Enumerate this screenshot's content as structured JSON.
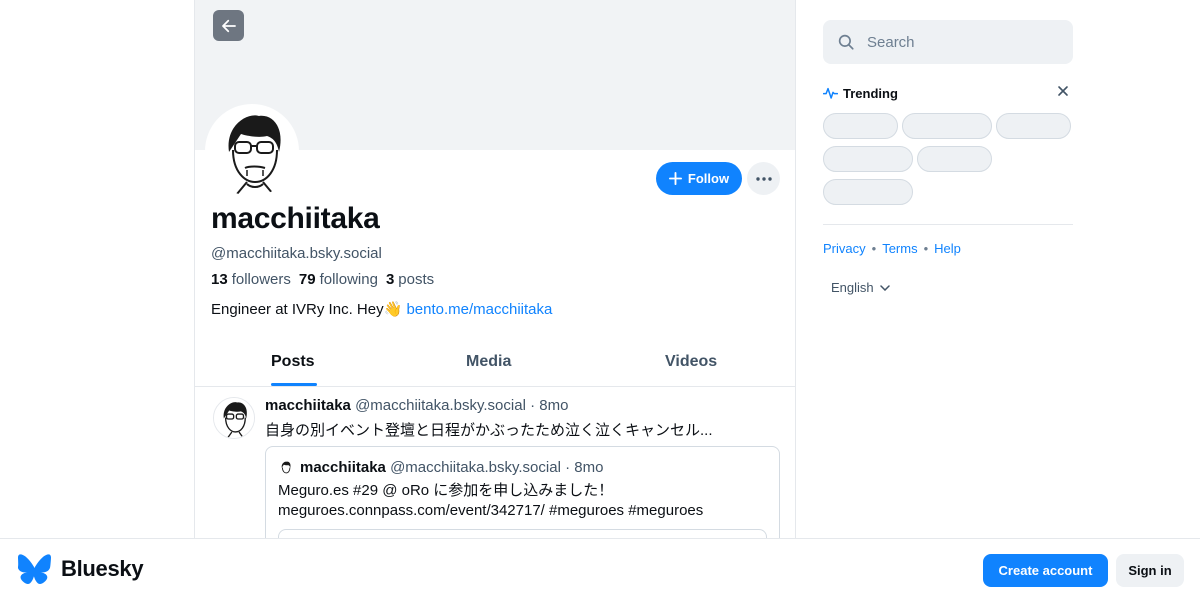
{
  "profile": {
    "display_name": "macchiitaka",
    "handle": "@macchiitaka.bsky.social",
    "followers_count": "13",
    "followers_label": "followers",
    "following_count": "79",
    "following_label": "following",
    "posts_count": "3",
    "posts_label": "posts",
    "bio_text": "Engineer at IVRy Inc. Hey👋 ",
    "bio_link": "bento.me/macchiitaka",
    "follow_label": "Follow"
  },
  "tabs": [
    {
      "label": "Posts",
      "active": true
    },
    {
      "label": "Media",
      "active": false
    },
    {
      "label": "Videos",
      "active": false
    }
  ],
  "post": {
    "author": "macchiitaka",
    "handle": "@macchiitaka.bsky.social",
    "sep": "·",
    "time": "8mo",
    "text": "自身の別イベント登壇と日程がかぶったため泣く泣くキャンセル...",
    "quote": {
      "author": "macchiitaka",
      "handle": "@macchiitaka.bsky.social",
      "sep": "·",
      "time": "8mo",
      "line1": "Meguro.es #29 @ oRo に参加を申し込みました！",
      "line2": "meguroes.connpass.com/event/342717/ #meguroes  #meguroes"
    }
  },
  "sidebar": {
    "search_placeholder": "Search",
    "trending_title": "Trending",
    "links": [
      "Privacy",
      "Terms",
      "Help"
    ],
    "language": "English"
  },
  "bottom_bar": {
    "brand": "Bluesky",
    "create_account": "Create account",
    "sign_in": "Sign in"
  },
  "colors": {
    "accent": "#1083fe",
    "muted_text": "#425466",
    "banner": "#f1f3f5"
  }
}
